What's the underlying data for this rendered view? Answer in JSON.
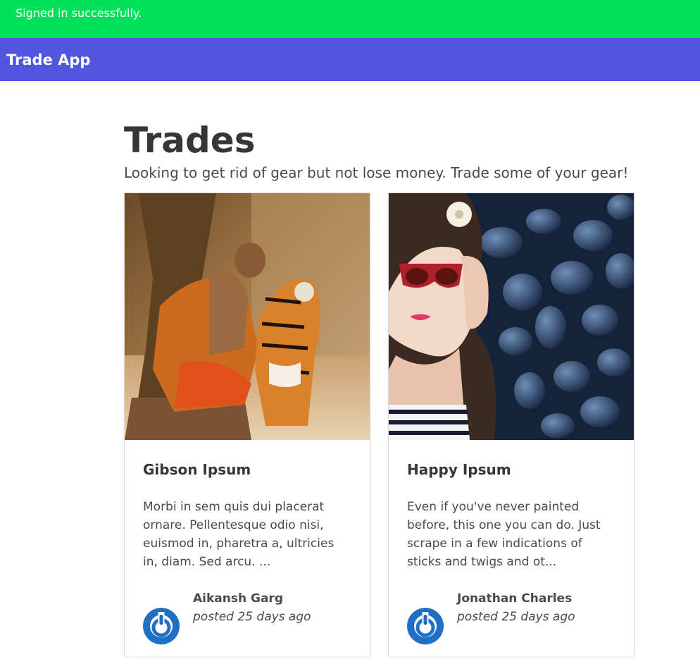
{
  "flash": {
    "message": "Signed in successfully."
  },
  "navbar": {
    "brand": "Trade App",
    "color": "#5056df"
  },
  "flash_color": "#00e15a",
  "page": {
    "title": "Trades",
    "subtitle": "Looking to get rid of gear but not lose money. Trade some of your gear!"
  },
  "cards": [
    {
      "image_icon": "photo-monk-feeding-tiger",
      "title": "Gibson Ipsum",
      "description": "Morbi in sem quis dui placerat ornare. Pellentesque odio nisi, euismod in, pharetra a, ultricies in, diam. Sed arcu. ...",
      "author": "Aikansh Garg",
      "posted": "posted 25 days ago",
      "avatar_icon": "power-avatar-icon"
    },
    {
      "image_icon": "photo-woman-sunglasses-stones",
      "title": "Happy Ipsum",
      "description": "Even if you've never painted before, this one you can do. Just scrape in a few indications of sticks and twigs and ot...",
      "author": "Jonathan Charles",
      "posted": "posted 25 days ago",
      "avatar_icon": "power-avatar-icon"
    }
  ]
}
